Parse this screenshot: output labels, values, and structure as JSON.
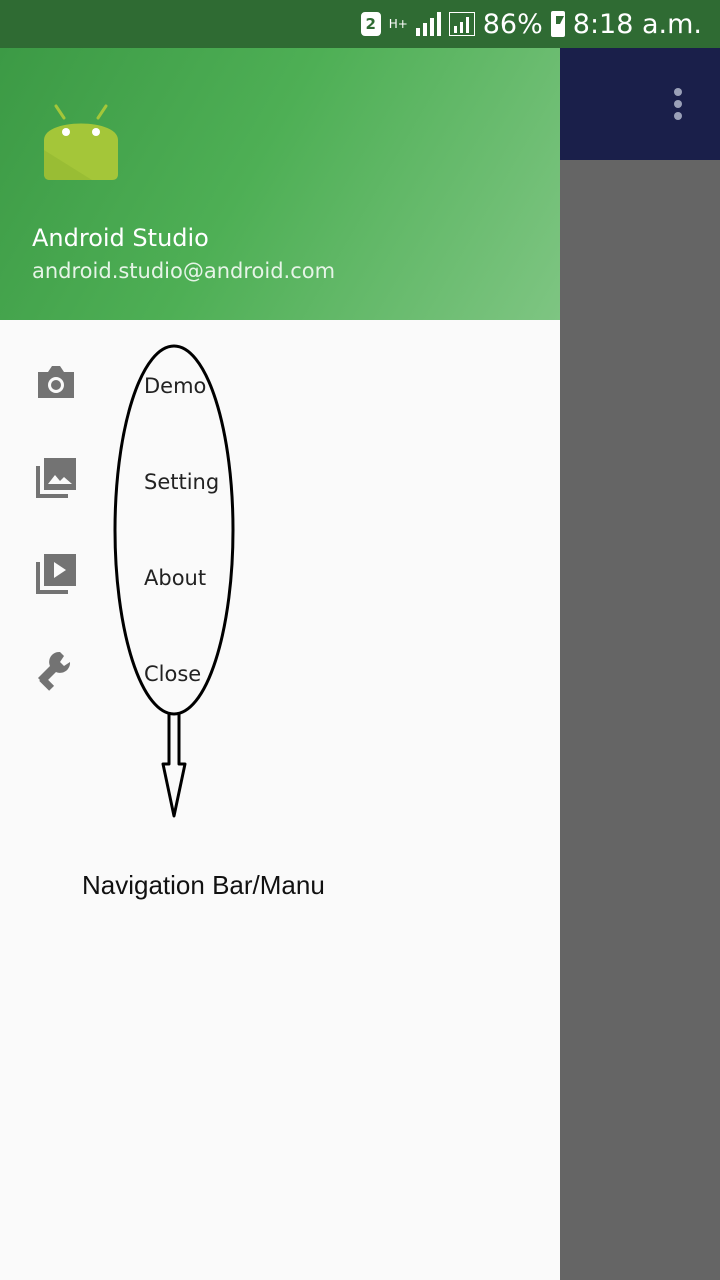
{
  "status_bar": {
    "sim_slot": "2",
    "network_type": "H+",
    "battery_percent": "86%",
    "time": "8:18 a.m."
  },
  "drawer_header": {
    "name": "Android Studio",
    "email": "android.studio@android.com"
  },
  "menu": {
    "items": [
      {
        "label": "Demo",
        "icon": "camera-icon"
      },
      {
        "label": "Setting",
        "icon": "gallery-icon"
      },
      {
        "label": "About",
        "icon": "slideshow-icon"
      },
      {
        "label": "Close",
        "icon": "wrench-icon"
      }
    ]
  },
  "annotation": {
    "caption": "Navigation Bar/Manu"
  },
  "colors": {
    "status_bar": "#2f6b33",
    "header_green": "#4eaf55",
    "app_bar": "#1a1f4a",
    "scrim": "#656565"
  }
}
